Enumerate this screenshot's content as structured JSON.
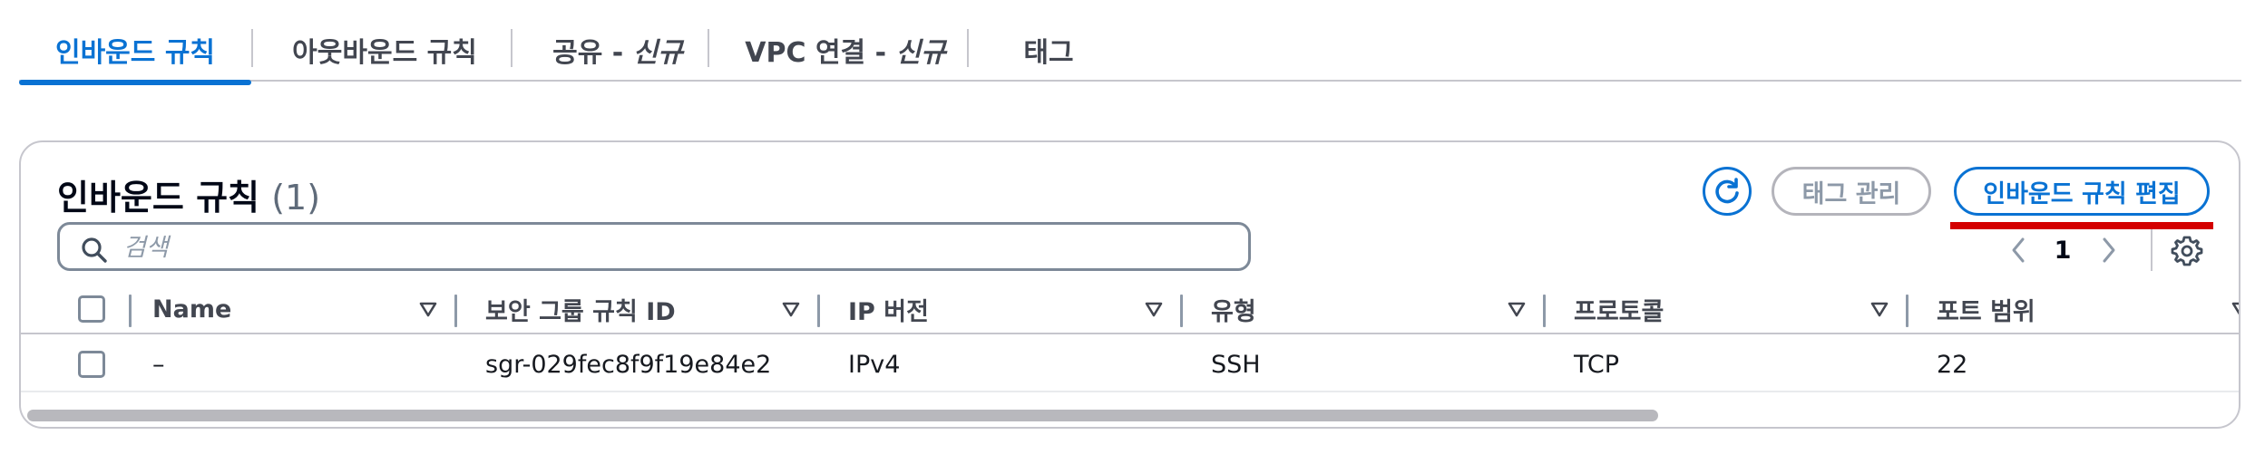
{
  "tabs": [
    {
      "label": "인바운드 규칙",
      "active": true
    },
    {
      "label": "아웃바운드 규칙",
      "active": false
    },
    {
      "label": "공유 - ",
      "badge": "신규",
      "active": false
    },
    {
      "label": "VPC 연결 - ",
      "badge": "신규",
      "active": false
    },
    {
      "label": "태그",
      "active": false
    }
  ],
  "panel": {
    "title": "인바운드 규칙",
    "count": "(1)",
    "refresh_icon": "refresh-icon",
    "manage_tags_label": "태그 관리",
    "edit_inbound_label": "인바운드 규칙 편집",
    "search_placeholder": "검색",
    "search_value": "",
    "page_number": "1",
    "accent_color": "#0972d3",
    "highlight_color": "#d40000"
  },
  "table": {
    "columns": [
      "Name",
      "보안 그룹 규칙 ID",
      "IP 버전",
      "유형",
      "프로토콜",
      "포트 범위"
    ],
    "rows": [
      {
        "name": "–",
        "rule_id": "sgr-029fec8f9f19e84e2",
        "ip_version": "IPv4",
        "type": "SSH",
        "protocol": "TCP",
        "port_range": "22"
      }
    ]
  }
}
